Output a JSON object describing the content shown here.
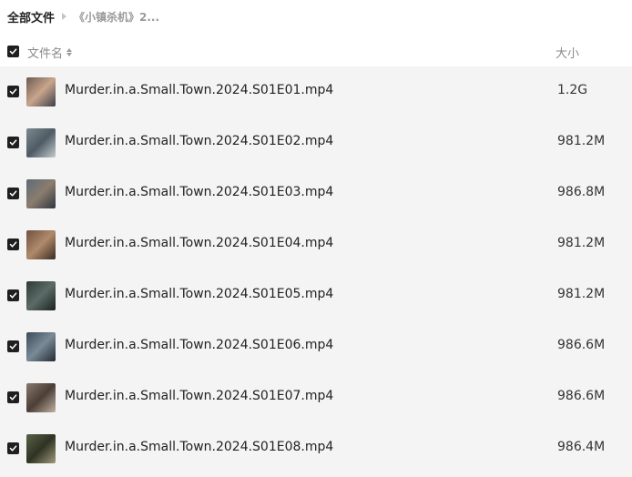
{
  "breadcrumb": {
    "root": "全部文件",
    "current": "《小镇杀机》2..."
  },
  "header": {
    "name_label": "文件名",
    "size_label": "大小",
    "all_selected": true
  },
  "files": [
    {
      "name": "Murder.in.a.Small.Town.2024.S01E01.mp4",
      "size": "1.2G",
      "selected": true,
      "thumb_colors": [
        "#6b5a52",
        "#c9a58c",
        "#3a3f4a"
      ]
    },
    {
      "name": "Murder.in.a.Small.Town.2024.S01E02.mp4",
      "size": "981.2M",
      "selected": true,
      "thumb_colors": [
        "#7d8a8f",
        "#4e5b64",
        "#c4ccd0"
      ]
    },
    {
      "name": "Murder.in.a.Small.Town.2024.S01E03.mp4",
      "size": "986.8M",
      "selected": true,
      "thumb_colors": [
        "#5d6a78",
        "#8b7d6e",
        "#2e3640"
      ]
    },
    {
      "name": "Murder.in.a.Small.Town.2024.S01E04.mp4",
      "size": "981.2M",
      "selected": true,
      "thumb_colors": [
        "#6e5140",
        "#b08a6a",
        "#3a2a22"
      ]
    },
    {
      "name": "Murder.in.a.Small.Town.2024.S01E05.mp4",
      "size": "981.2M",
      "selected": true,
      "thumb_colors": [
        "#2f3a38",
        "#5b6b66",
        "#1b2222"
      ]
    },
    {
      "name": "Murder.in.a.Small.Town.2024.S01E06.mp4",
      "size": "986.6M",
      "selected": true,
      "thumb_colors": [
        "#3c4a5a",
        "#7a8a96",
        "#222a33"
      ]
    },
    {
      "name": "Murder.in.a.Small.Town.2024.S01E07.mp4",
      "size": "986.6M",
      "selected": true,
      "thumb_colors": [
        "#8a7a6c",
        "#4a3e36",
        "#c2b2a2"
      ]
    },
    {
      "name": "Murder.in.a.Small.Town.2024.S01E08.mp4",
      "size": "986.4M",
      "selected": true,
      "thumb_colors": [
        "#5a6246",
        "#2e3322",
        "#a49a7c"
      ]
    }
  ]
}
